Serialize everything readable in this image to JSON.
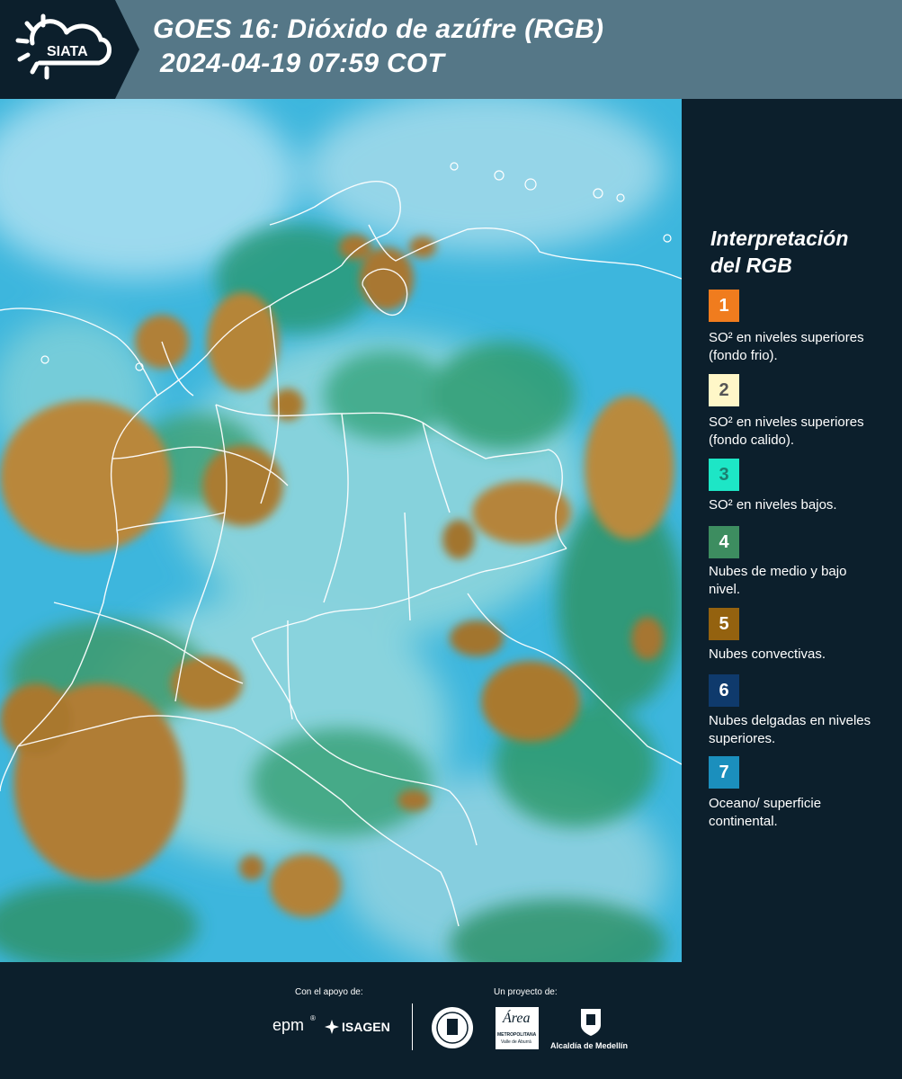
{
  "header": {
    "logo_text": "SIATA",
    "title_line1": "GOES 16: Dióxido de azúfre (RGB)",
    "title_line2": "2024-04-19 07:59 COT"
  },
  "legend": {
    "title_line1": "Interpretación",
    "title_line2": "del RGB",
    "items": [
      {
        "number": "1",
        "color": "#f07c1e",
        "text_color": "#ffffff",
        "desc": "SO² en niveles superiores (fondo frio)."
      },
      {
        "number": "2",
        "color": "#fff7c8",
        "text_color": "#555555",
        "desc": "SO² en niveles superiores (fondo calido)."
      },
      {
        "number": "3",
        "color": "#1de6c6",
        "text_color": "#1b7f70",
        "desc": "SO² en niveles bajos."
      },
      {
        "number": "4",
        "color": "#3d8d60",
        "text_color": "#ffffff",
        "desc": "Nubes de medio y bajo nivel."
      },
      {
        "number": "5",
        "color": "#94620f",
        "text_color": "#ffffff",
        "desc": "Nubes convectivas."
      },
      {
        "number": "6",
        "color": "#0f3a6c",
        "text_color": "#ffffff",
        "desc": "Nubes delgadas en niveles superiores."
      },
      {
        "number": "7",
        "color": "#1b8fbd",
        "text_color": "#ffffff",
        "desc": "Oceano/ superficie continental."
      }
    ]
  },
  "footer": {
    "support_label": "Con el apoyo de:",
    "project_label": "Un proyecto de:",
    "sponsor_epm": "epm",
    "sponsor_isagen": "ISAGEN",
    "area_logo_text": "Área",
    "area_sub1": "METROPOLITANA",
    "area_sub2": "Valle de Aburrá",
    "alcaldia": "Alcaldía de Medellín"
  },
  "map": {
    "ocean_color": "#37b5e0",
    "cloud_light_color": "#9fdbe9",
    "low_cloud_color": "#1fa889",
    "convective_color": "#a07a2a",
    "border_color": "#ffffff"
  }
}
